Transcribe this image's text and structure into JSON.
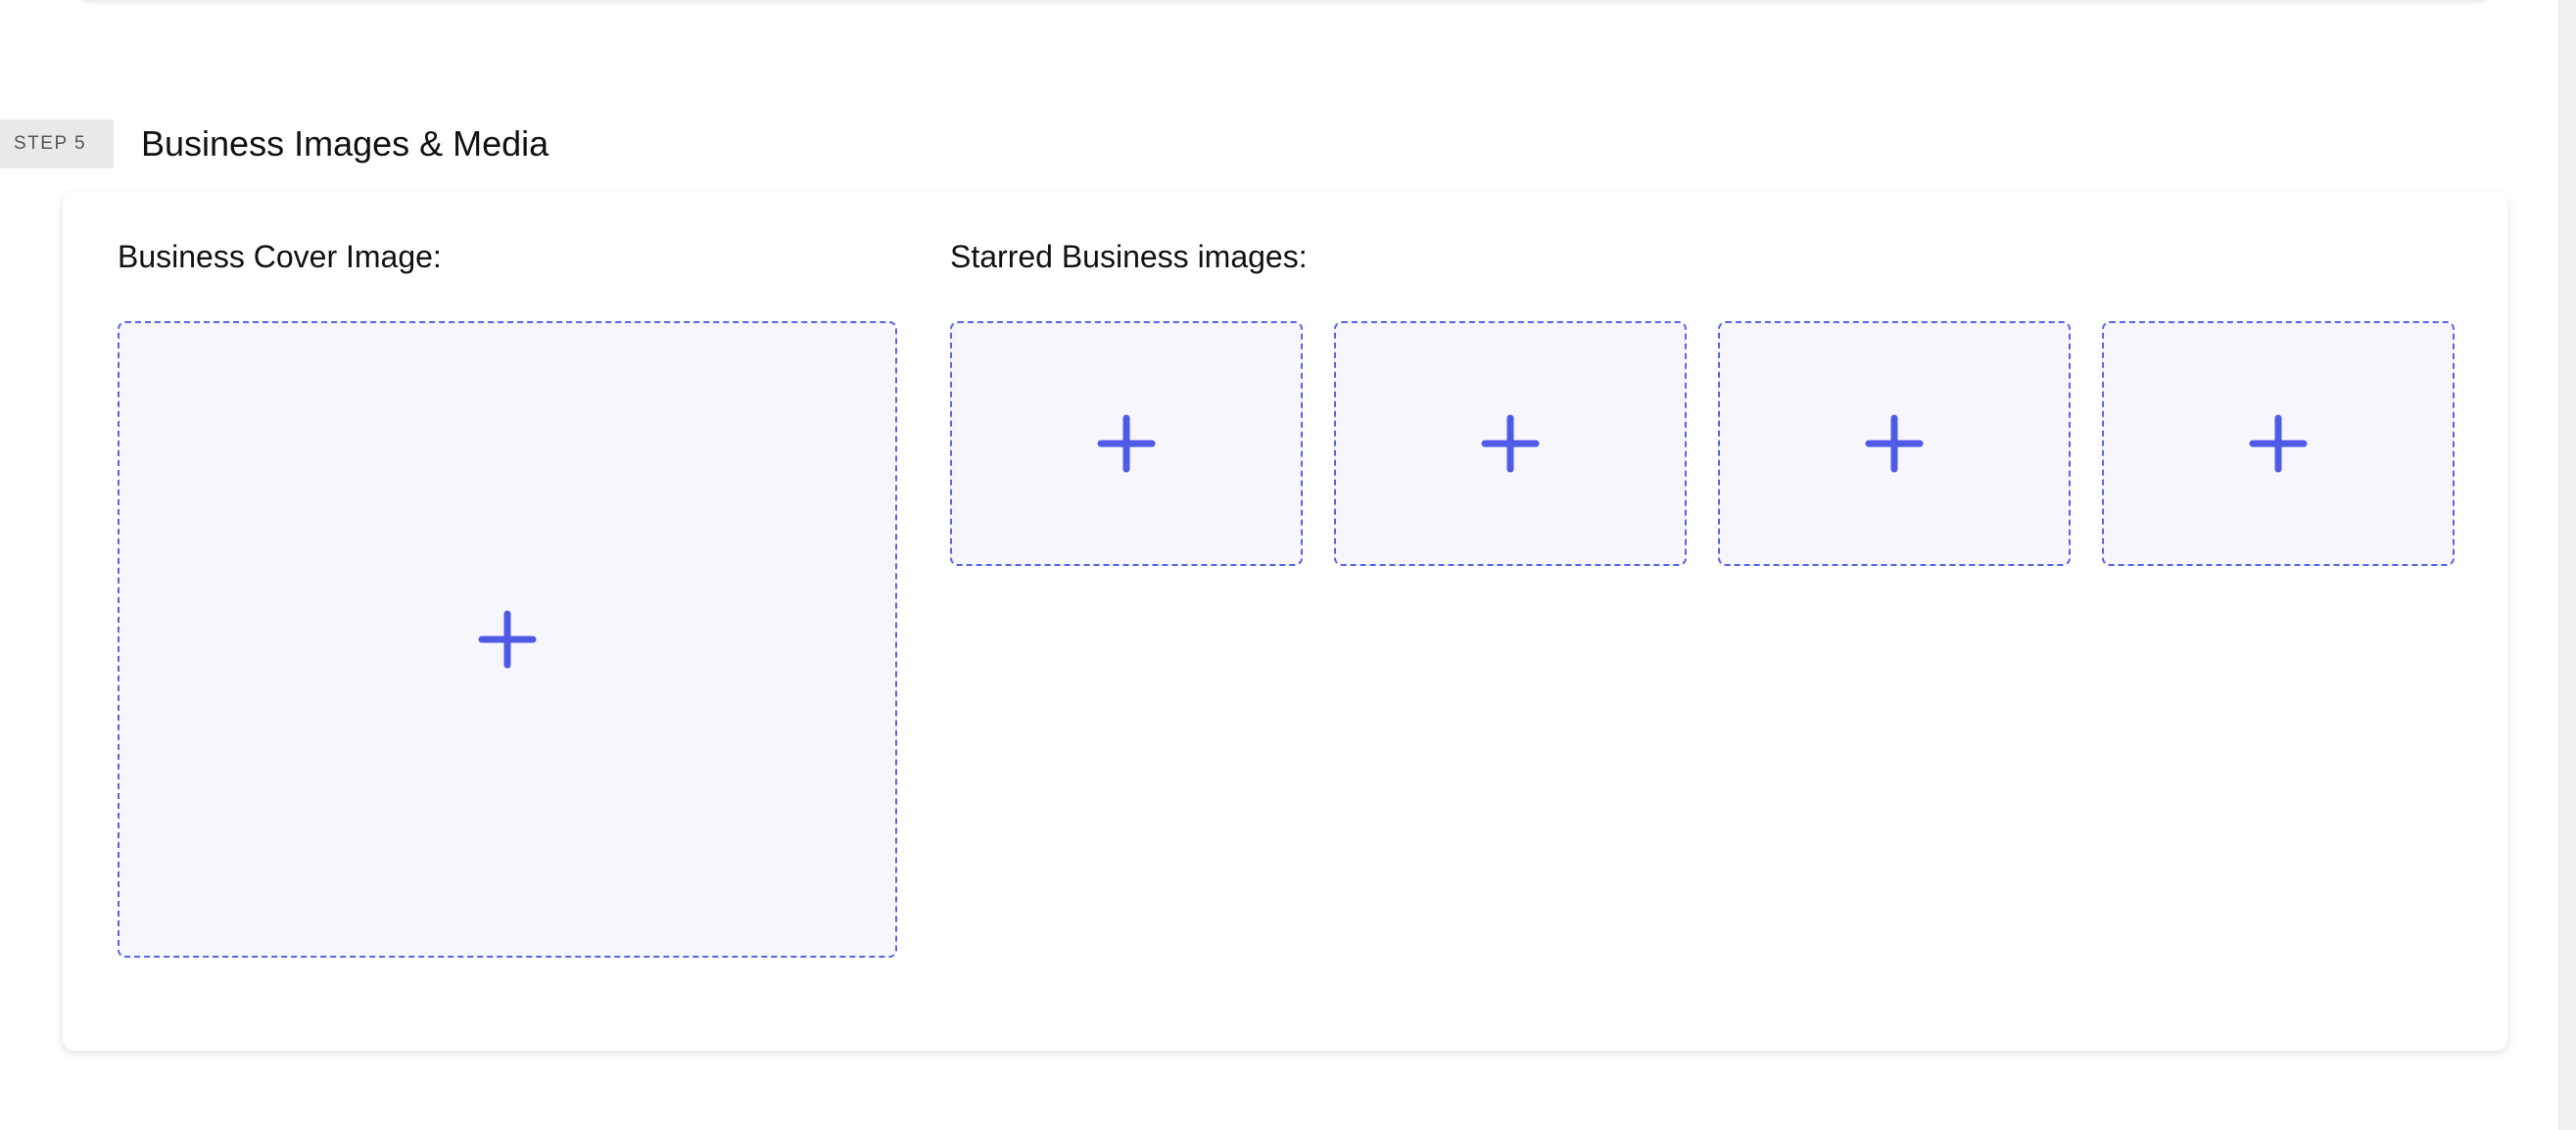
{
  "step": {
    "badge": "STEP 5",
    "title": "Business Images & Media"
  },
  "cover": {
    "label": "Business Cover Image:",
    "icon": "plus-icon"
  },
  "starred": {
    "label": "Starred Business images:",
    "slots": [
      {
        "icon": "plus-icon"
      },
      {
        "icon": "plus-icon"
      },
      {
        "icon": "plus-icon"
      },
      {
        "icon": "plus-icon"
      }
    ]
  },
  "colors": {
    "accent": "#4f5be6",
    "dropzone_bg": "#f6f6fc",
    "badge_bg": "#e9e9e9"
  }
}
